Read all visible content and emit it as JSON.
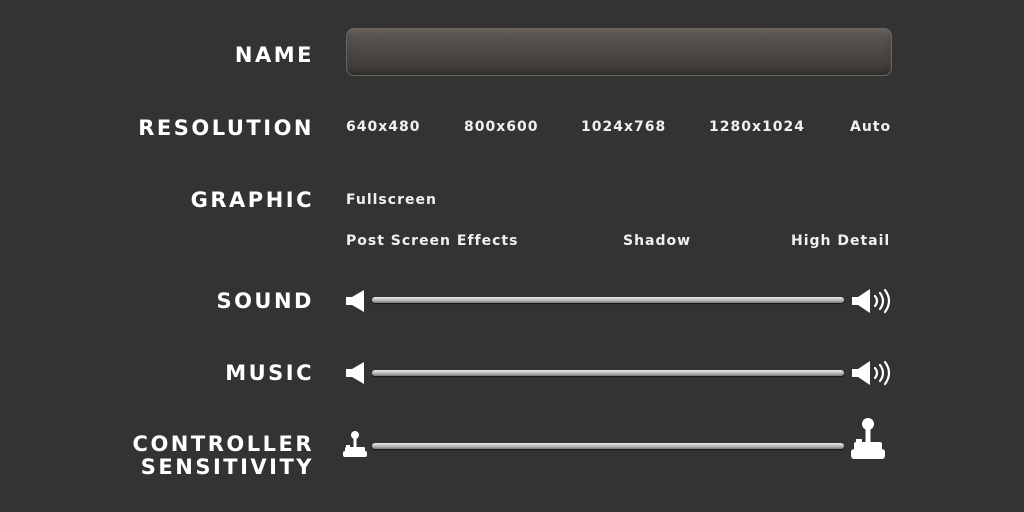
{
  "name": {
    "label": "NAME",
    "value": "",
    "placeholder": ""
  },
  "resolution": {
    "label": "RESOLUTION",
    "options": [
      "640x480",
      "800x600",
      "1024x768",
      "1280x1024",
      "Auto"
    ]
  },
  "graphic": {
    "label": "GRAPHIC",
    "options": [
      "Fullscreen",
      "Post Screen Effects",
      "Shadow",
      "High Detail"
    ]
  },
  "sound": {
    "label": "SOUND",
    "min_icon": "speaker-mute-icon",
    "max_icon": "speaker-loud-icon"
  },
  "music": {
    "label": "MUSIC",
    "min_icon": "speaker-mute-icon",
    "max_icon": "speaker-loud-icon"
  },
  "controller": {
    "label_line1": "CONTROLLER",
    "label_line2": "SENSITIVITY",
    "min_icon": "joystick-small-icon",
    "max_icon": "joystick-large-icon"
  },
  "colors": {
    "background": "#333333",
    "text": "#ffffff",
    "track": "#bdbdbd"
  }
}
